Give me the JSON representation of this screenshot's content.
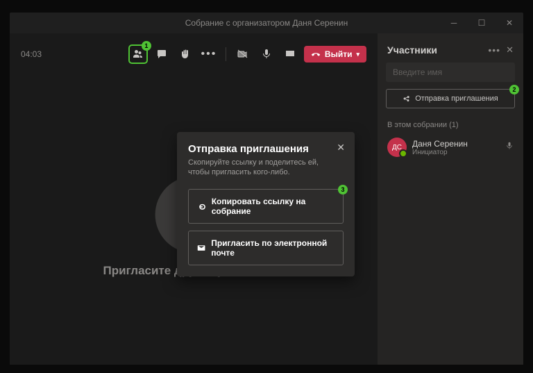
{
  "title": "Собрание с организатором Даня Серенин",
  "timer": "04:03",
  "leave": "Выйти",
  "main": {
    "invite_cta": "Пригласите других участников"
  },
  "panel": {
    "title": "Участники",
    "search_placeholder": "Введите имя",
    "share_invite": "Отправка приглашения",
    "section": "В этом собрании (1)",
    "participant": {
      "initials": "ДС",
      "name": "Даня Серенин",
      "role": "Инициатор"
    }
  },
  "modal": {
    "title": "Отправка приглашения",
    "subtitle": "Скопируйте ссылку и поделитесь ей, чтобы пригласить кого-либо.",
    "copy_link": "Копировать ссылку на собрание",
    "email_invite": "Пригласить по электронной почте"
  },
  "badges": {
    "b1": "1",
    "b2": "2",
    "b3": "3"
  }
}
